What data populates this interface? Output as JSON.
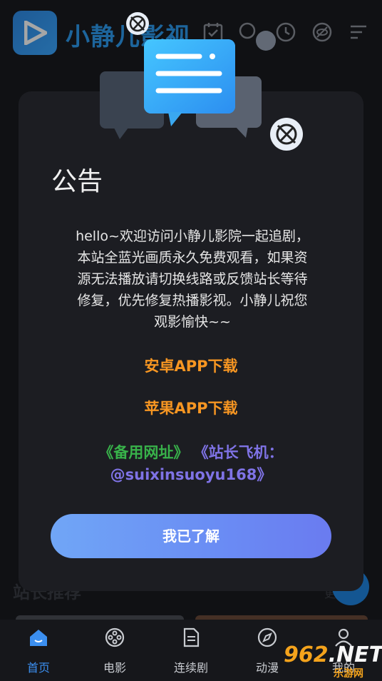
{
  "app": {
    "title": "小静儿影视"
  },
  "announcement": {
    "title": "公告",
    "body_lines": [
      "hello~欢迎访问小静儿影院一起追剧，",
      "本站全蓝光画质永久免费观看，如果资",
      "源无法播放请切换线路或反馈站长等待",
      "修复，优先修复热播影视。小静儿祝您",
      "观影愉快~~"
    ],
    "android_link": "安卓APP下载",
    "ios_link": "苹果APP下载",
    "backup_link": "《备用网址》",
    "contact_link_line1": "《站长飞机：",
    "contact_link_line2": "@suixinsuoyu168》",
    "ack_button": "我已了解"
  },
  "background": {
    "section_title": "站长推荐",
    "more_label": "更"
  },
  "bottom_nav": [
    {
      "label": "首页",
      "icon": "home-icon",
      "active": true
    },
    {
      "label": "电影",
      "icon": "film-reel-icon",
      "active": false
    },
    {
      "label": "连续剧",
      "icon": "document-icon",
      "active": false
    },
    {
      "label": "动漫",
      "icon": "compass-icon",
      "active": false
    },
    {
      "label": "我的",
      "icon": "user-icon",
      "active": false
    }
  ],
  "watermark": {
    "main_prefix": "",
    "num": "962",
    "suffix": ".NET",
    "sub": "乐游网"
  },
  "colors": {
    "accent": "#2d9cf0",
    "orange": "#f79622",
    "green": "#38b24a",
    "purple": "#7f73e6"
  }
}
